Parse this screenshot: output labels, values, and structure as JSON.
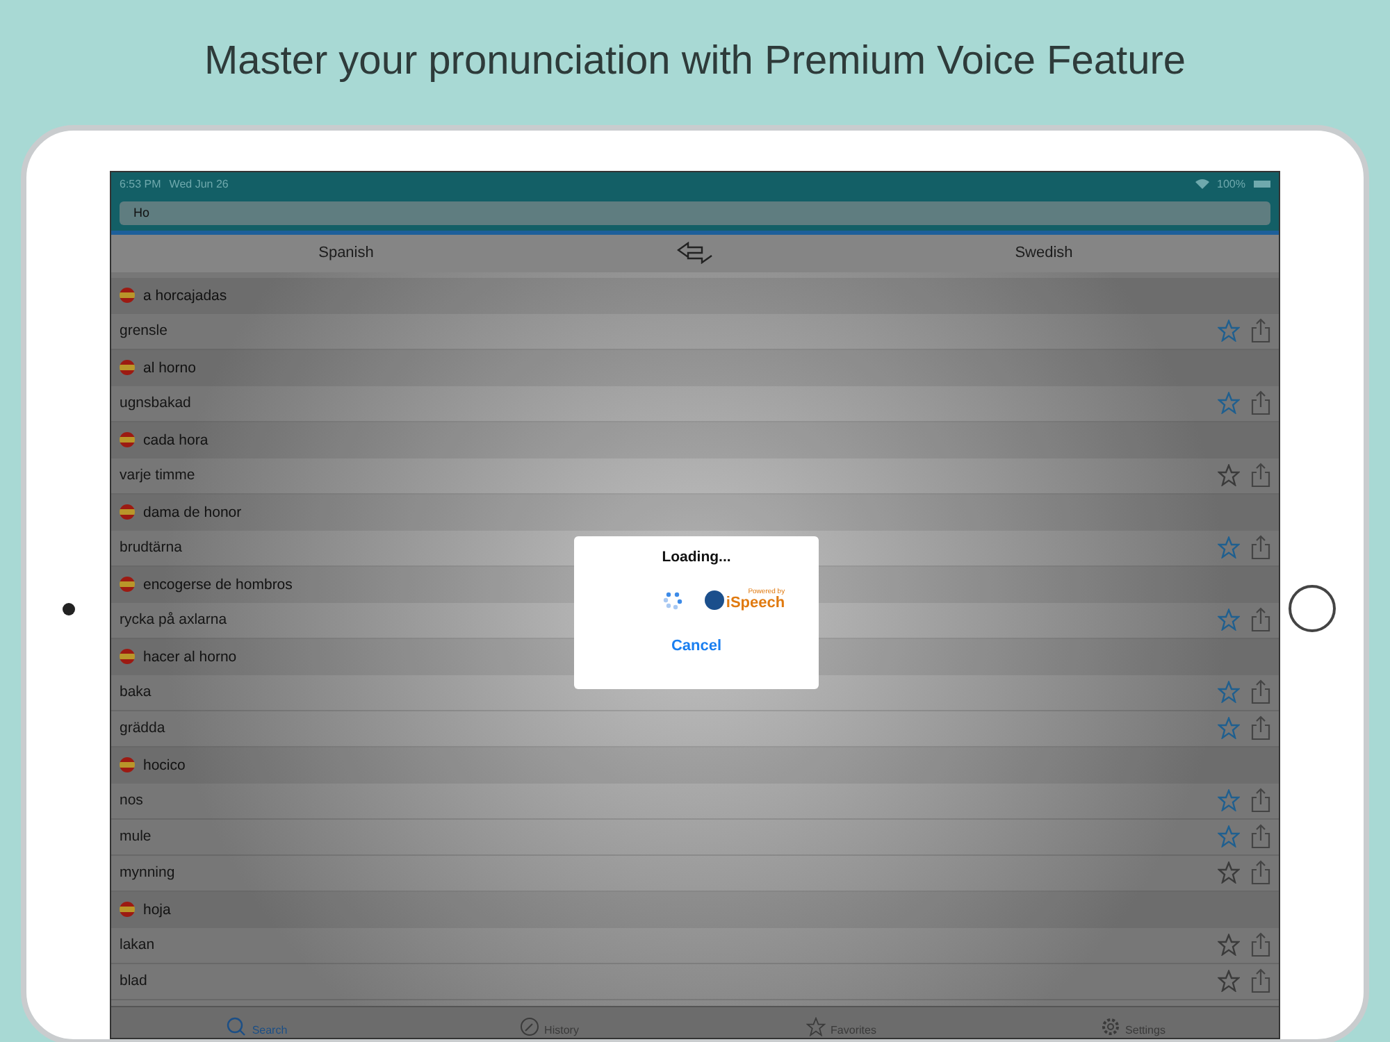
{
  "headline": "Master your pronunciation with Premium Voice Feature",
  "status_bar": {
    "time": "6:53 PM",
    "date": "Wed Jun 26",
    "battery": "100%"
  },
  "search": {
    "value": "Ho"
  },
  "languages": {
    "source": "Spanish",
    "target": "Swedish"
  },
  "entries": [
    {
      "word": "a horcajadas",
      "translations": [
        {
          "text": "grensle",
          "starred": true
        }
      ]
    },
    {
      "word": "al horno",
      "translations": [
        {
          "text": "ugnsbakad",
          "starred": true
        }
      ]
    },
    {
      "word": "cada hora",
      "translations": [
        {
          "text": "varje timme",
          "starred": false
        }
      ]
    },
    {
      "word": "dama de honor",
      "translations": [
        {
          "text": "brudtärna",
          "starred": true
        }
      ]
    },
    {
      "word": "encogerse de hombros",
      "translations": [
        {
          "text": "rycka på axlarna",
          "starred": true
        }
      ]
    },
    {
      "word": "hacer al horno",
      "translations": [
        {
          "text": "baka",
          "starred": true
        },
        {
          "text": "grädda",
          "starred": true
        }
      ]
    },
    {
      "word": "hocico",
      "translations": [
        {
          "text": "nos",
          "starred": true
        },
        {
          "text": "mule",
          "starred": true
        },
        {
          "text": "mynning",
          "starred": false
        }
      ]
    },
    {
      "word": "hoja",
      "translations": [
        {
          "text": "lakan",
          "starred": false
        },
        {
          "text": "blad",
          "starred": false
        }
      ]
    }
  ],
  "dialog": {
    "title": "Loading...",
    "badge_top": "Powered by",
    "badge_brand": "iSpeech",
    "cancel": "Cancel"
  },
  "tabs": [
    {
      "label": "Search",
      "kind": "search",
      "selected": true
    },
    {
      "label": "History",
      "kind": "history",
      "selected": false
    },
    {
      "label": "Favorites",
      "kind": "favorites",
      "selected": false
    },
    {
      "label": "Settings",
      "kind": "settings",
      "selected": false
    }
  ]
}
